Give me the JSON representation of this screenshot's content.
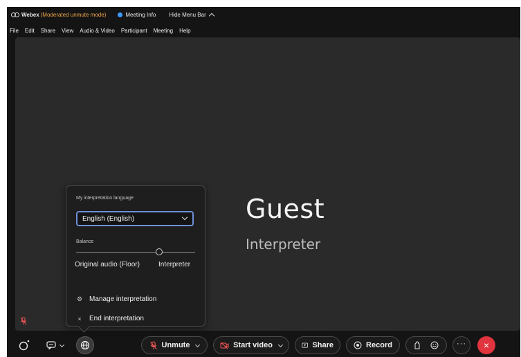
{
  "titlebar": {
    "app_name": "Webex",
    "mode": "(Moderated unmute mode)",
    "meeting_info": "Meeting Info",
    "hide_menu": "Hide Menu Bar"
  },
  "menu": [
    "File",
    "Edit",
    "Share",
    "View",
    "Audio & Video",
    "Participant",
    "Meeting",
    "Help"
  ],
  "participant": {
    "name": "Guest",
    "role": "Interpreter"
  },
  "interpretation_popup": {
    "language_label": "My interpretation language",
    "selected_language": "English (English)",
    "balance_label": "Balance",
    "balance_left": "Original audio (Floor)",
    "balance_right": "Interpreter",
    "balance_level": 0.7,
    "manage": "Manage interpretation",
    "end": "End interpretation"
  },
  "controls": {
    "unmute": "Unmute",
    "start_video": "Start video",
    "share": "Share",
    "record": "Record"
  },
  "colors": {
    "mode_text": "#f0a54a",
    "end_button": "#e0343f",
    "muted_red": "#ff5a5a",
    "focus_outline": "#6f8fd9"
  }
}
